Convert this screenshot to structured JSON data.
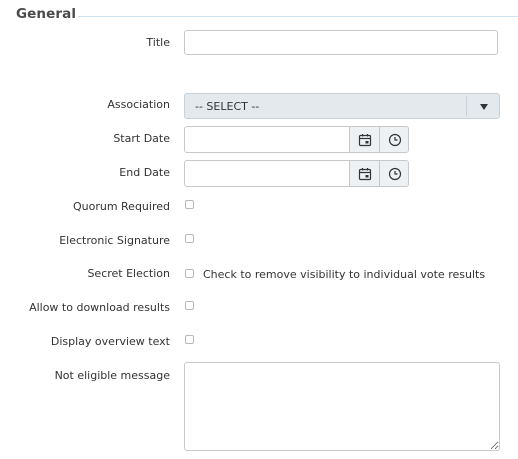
{
  "section": {
    "title": "General"
  },
  "fields": {
    "title": {
      "label": "Title",
      "value": ""
    },
    "association": {
      "label": "Association",
      "selected": "-- SELECT --"
    },
    "start_date": {
      "label": "Start Date",
      "value": "",
      "calendar_icon": "calendar-icon",
      "time_icon": "clock-icon"
    },
    "end_date": {
      "label": "End Date",
      "value": "",
      "calendar_icon": "calendar-icon",
      "time_icon": "clock-icon"
    },
    "quorum_required": {
      "label": "Quorum Required",
      "checked": false
    },
    "electronic_signature": {
      "label": "Electronic Signature",
      "checked": false
    },
    "secret_election": {
      "label": "Secret Election",
      "checked": false,
      "hint": "Check to remove visibility to individual vote results"
    },
    "allow_download": {
      "label": "Allow to download results",
      "checked": false
    },
    "display_overview": {
      "label": "Display overview text",
      "checked": false
    },
    "not_eligible_message": {
      "label": "Not eligible message",
      "value": ""
    }
  },
  "colors": {
    "section_rule": "#cfe1ee",
    "select_bg": "#e4e9ee",
    "button_bg": "#eef1f4"
  }
}
